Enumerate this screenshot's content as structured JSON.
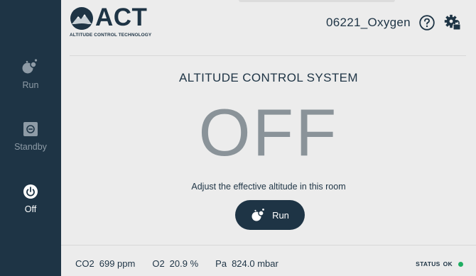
{
  "sidebar": {
    "items": [
      {
        "label": "Run",
        "icon": "run-icon",
        "active": false
      },
      {
        "label": "Standby",
        "icon": "standby-icon",
        "active": false
      },
      {
        "label": "Off",
        "icon": "power-icon",
        "active": true
      }
    ]
  },
  "header": {
    "logo_text": "ACT",
    "logo_tagline": "ALTITUDE CONTROL TECHNOLOGY",
    "device_name": "06221_Oxygen",
    "help_icon": "help-icon",
    "settings_icon": "settings-lock-icon"
  },
  "main": {
    "title": "ALTITUDE CONTROL SYSTEM",
    "state": "OFF",
    "hint": "Adjust the effective altitude in this room",
    "run_button_label": "Run"
  },
  "footer": {
    "stats": [
      {
        "name": "CO2",
        "value": "699 ppm"
      },
      {
        "name": "O2",
        "value": "20.9 %"
      },
      {
        "name": "Pa",
        "value": "824.0 mbar"
      }
    ],
    "status_label": "STATUS",
    "status_value": "OK",
    "status_color": "#1fae62"
  },
  "colors": {
    "sidebar": "#1e3445",
    "accent": "#1e3445",
    "state_text": "#8a9399",
    "background": "#ececec"
  }
}
